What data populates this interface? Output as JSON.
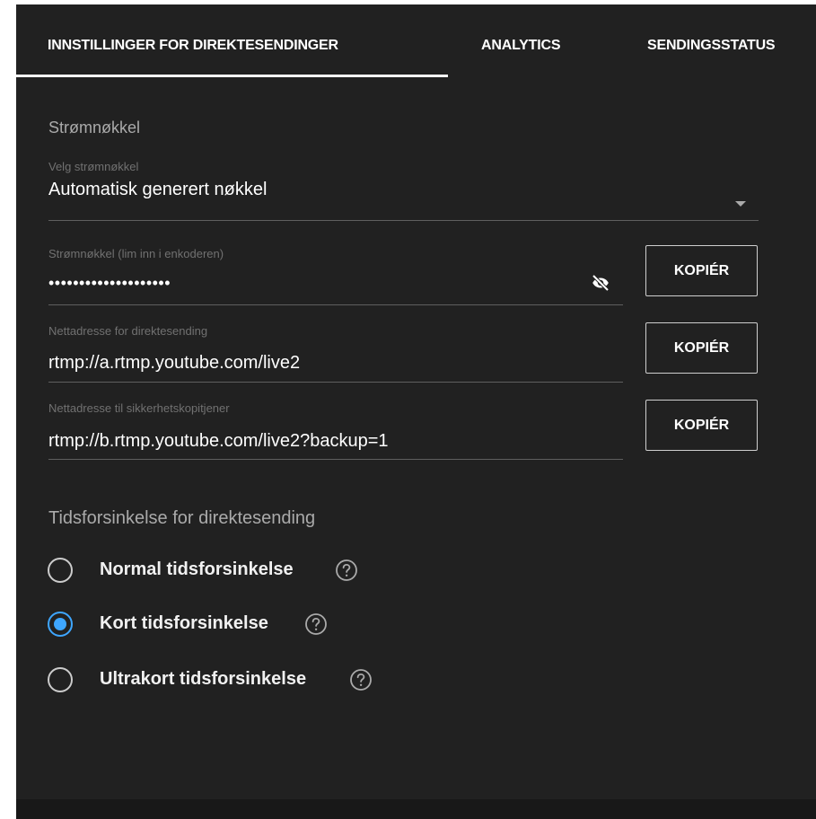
{
  "tabs": [
    {
      "label": "INNSTILLINGER FOR DIREKTESENDINGER",
      "active": true
    },
    {
      "label": "ANALYTICS",
      "active": false
    },
    {
      "label": "SENDINGSSTATUS",
      "active": false
    }
  ],
  "stream_key_section": {
    "title": "Strømnøkkel",
    "select_key": {
      "label": "Velg strømnøkkel",
      "value": "Automatisk generert nøkkel",
      "icon": "dropdown-arrow-icon"
    },
    "stream_key": {
      "label": "Strømnøkkel (lim inn i enkoderen)",
      "value": "••••••••••••••••••••",
      "icon": "eye-off-icon"
    },
    "server_url": {
      "label": "Nettadresse for direktesending",
      "value": "rtmp://a.rtmp.youtube.com/live2"
    },
    "backup_url": {
      "label": "Nettadresse til sikkerhetskopitjener",
      "value": "rtmp://b.rtmp.youtube.com/live2?backup=1"
    },
    "copy_label": "KOPIÉR"
  },
  "latency_section": {
    "title": "Tidsforsinkelse for direktesending",
    "options": [
      {
        "label": "Normal tidsforsinkelse",
        "selected": false
      },
      {
        "label": "Kort tidsforsinkelse",
        "selected": true
      },
      {
        "label": "Ultrakort tidsforsinkelse",
        "selected": false
      }
    ],
    "help_icon": "help-circle-icon"
  },
  "colors": {
    "background": "#212121",
    "accent": "#3ea6ff",
    "text": "#ffffff",
    "muted_text": "#aaaaaa"
  }
}
